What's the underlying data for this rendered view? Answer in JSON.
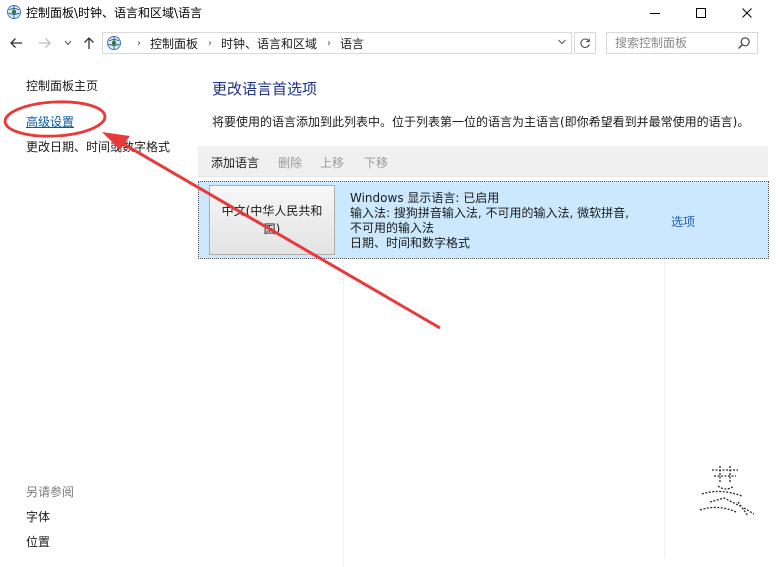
{
  "window": {
    "title": "控制面板\\时钟、语言和区域\\语言"
  },
  "address": {
    "crumbs": [
      "控制面板",
      "时钟、语言和区域",
      "语言"
    ]
  },
  "search": {
    "placeholder": "搜索控制面板"
  },
  "sidebar": {
    "home": "控制面板主页",
    "advanced": "高级设置",
    "datetime": "更改日期、时间或数字格式",
    "see_also": "另请参阅",
    "fonts": "字体",
    "location": "位置"
  },
  "main": {
    "title": "更改语言首选项",
    "description": "将要使用的语言添加到此列表中。位于列表第一位的语言为主语言(即你希望看到并最常使用的语言)。",
    "toolbar": {
      "add": "添加语言",
      "remove": "删除",
      "up": "上移",
      "down": "下移"
    },
    "languages": [
      {
        "name": "中文(中华人民共和国)",
        "info": [
          "Windows 显示语言: 已启用",
          "输入法: 搜狗拼音输入法, 不可用的输入法, 微软拼音,",
          "不可用的输入法",
          "日期、时间和数字格式"
        ],
        "options": "选项"
      }
    ]
  },
  "colors": {
    "selected_row": "#cce8ff",
    "link": "#1c5db0",
    "title": "#1e3287",
    "annotation": "#e8393b"
  }
}
